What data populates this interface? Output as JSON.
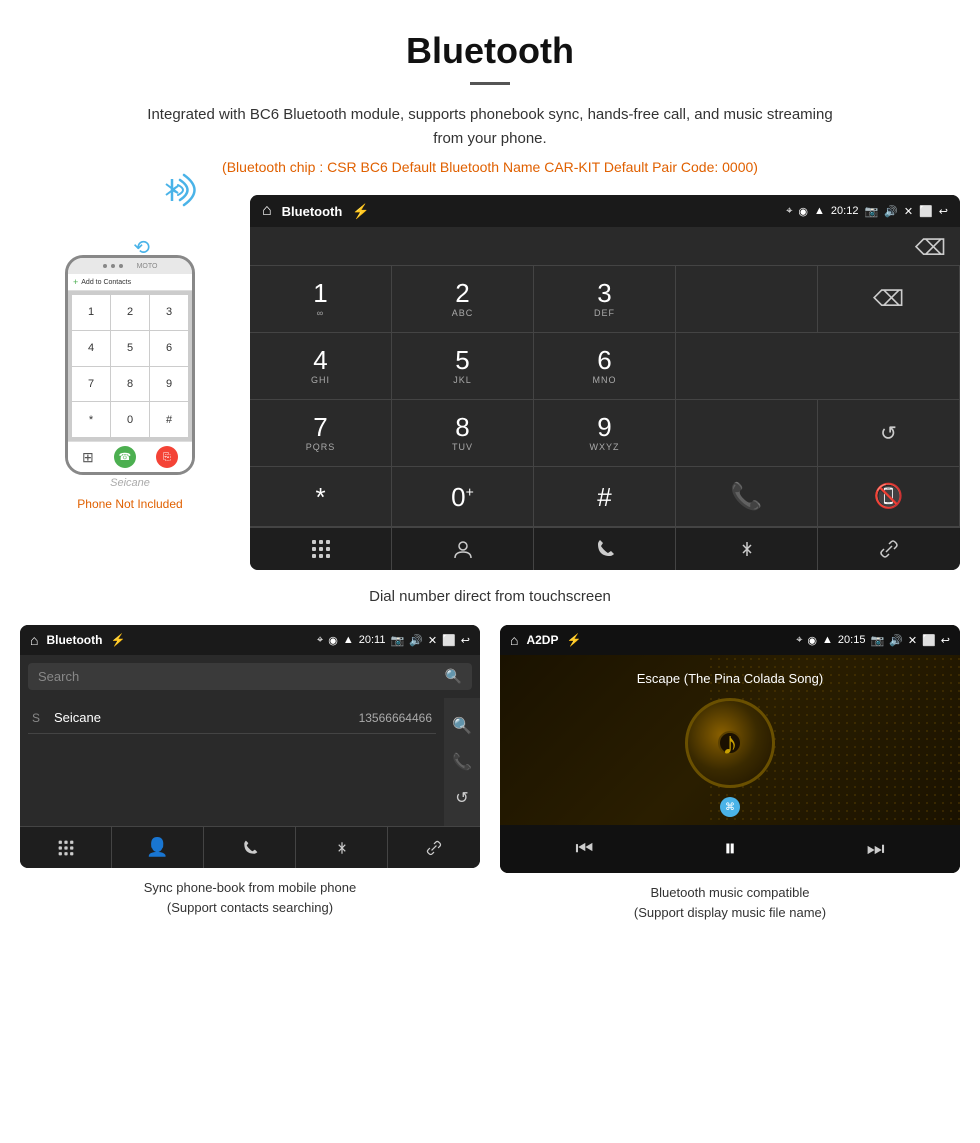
{
  "page": {
    "title": "Bluetooth",
    "description": "Integrated with BC6 Bluetooth module, supports phonebook sync, hands-free call, and music streaming from your phone.",
    "specs": "(Bluetooth chip : CSR BC6   Default Bluetooth Name CAR-KIT    Default Pair Code: 0000)",
    "main_caption": "Dial number direct from touchscreen",
    "bottom_left_caption_1": "Sync phone-book from mobile phone",
    "bottom_left_caption_2": "(Support contacts searching)",
    "bottom_right_caption_1": "Bluetooth music compatible",
    "bottom_right_caption_2": "(Support display music file name)"
  },
  "phone_not_included": "Phone Not Included",
  "seicane_watermark": "Seicane",
  "dial_screen": {
    "title": "Bluetooth",
    "time": "20:12",
    "keys": [
      {
        "num": "1",
        "letters": "∞"
      },
      {
        "num": "2",
        "letters": "ABC"
      },
      {
        "num": "3",
        "letters": "DEF"
      },
      {
        "num": "4",
        "letters": "GHI"
      },
      {
        "num": "5",
        "letters": "JKL"
      },
      {
        "num": "6",
        "letters": "MNO"
      },
      {
        "num": "7",
        "letters": "PQRS"
      },
      {
        "num": "8",
        "letters": "TUV"
      },
      {
        "num": "9",
        "letters": "WXYZ"
      },
      {
        "num": "*",
        "letters": ""
      },
      {
        "num": "0",
        "letters": "+"
      },
      {
        "num": "#",
        "letters": ""
      }
    ]
  },
  "phonebook_screen": {
    "title": "Bluetooth",
    "time": "20:11",
    "search_placeholder": "Search",
    "contacts": [
      {
        "letter": "S",
        "name": "Seicane",
        "number": "13566664466"
      }
    ]
  },
  "music_screen": {
    "title": "A2DP",
    "time": "20:15",
    "song_title": "Escape (The Pina Colada Song)",
    "controls": {
      "prev": "⏮",
      "play_pause": "⏸",
      "next": "⏭"
    }
  }
}
